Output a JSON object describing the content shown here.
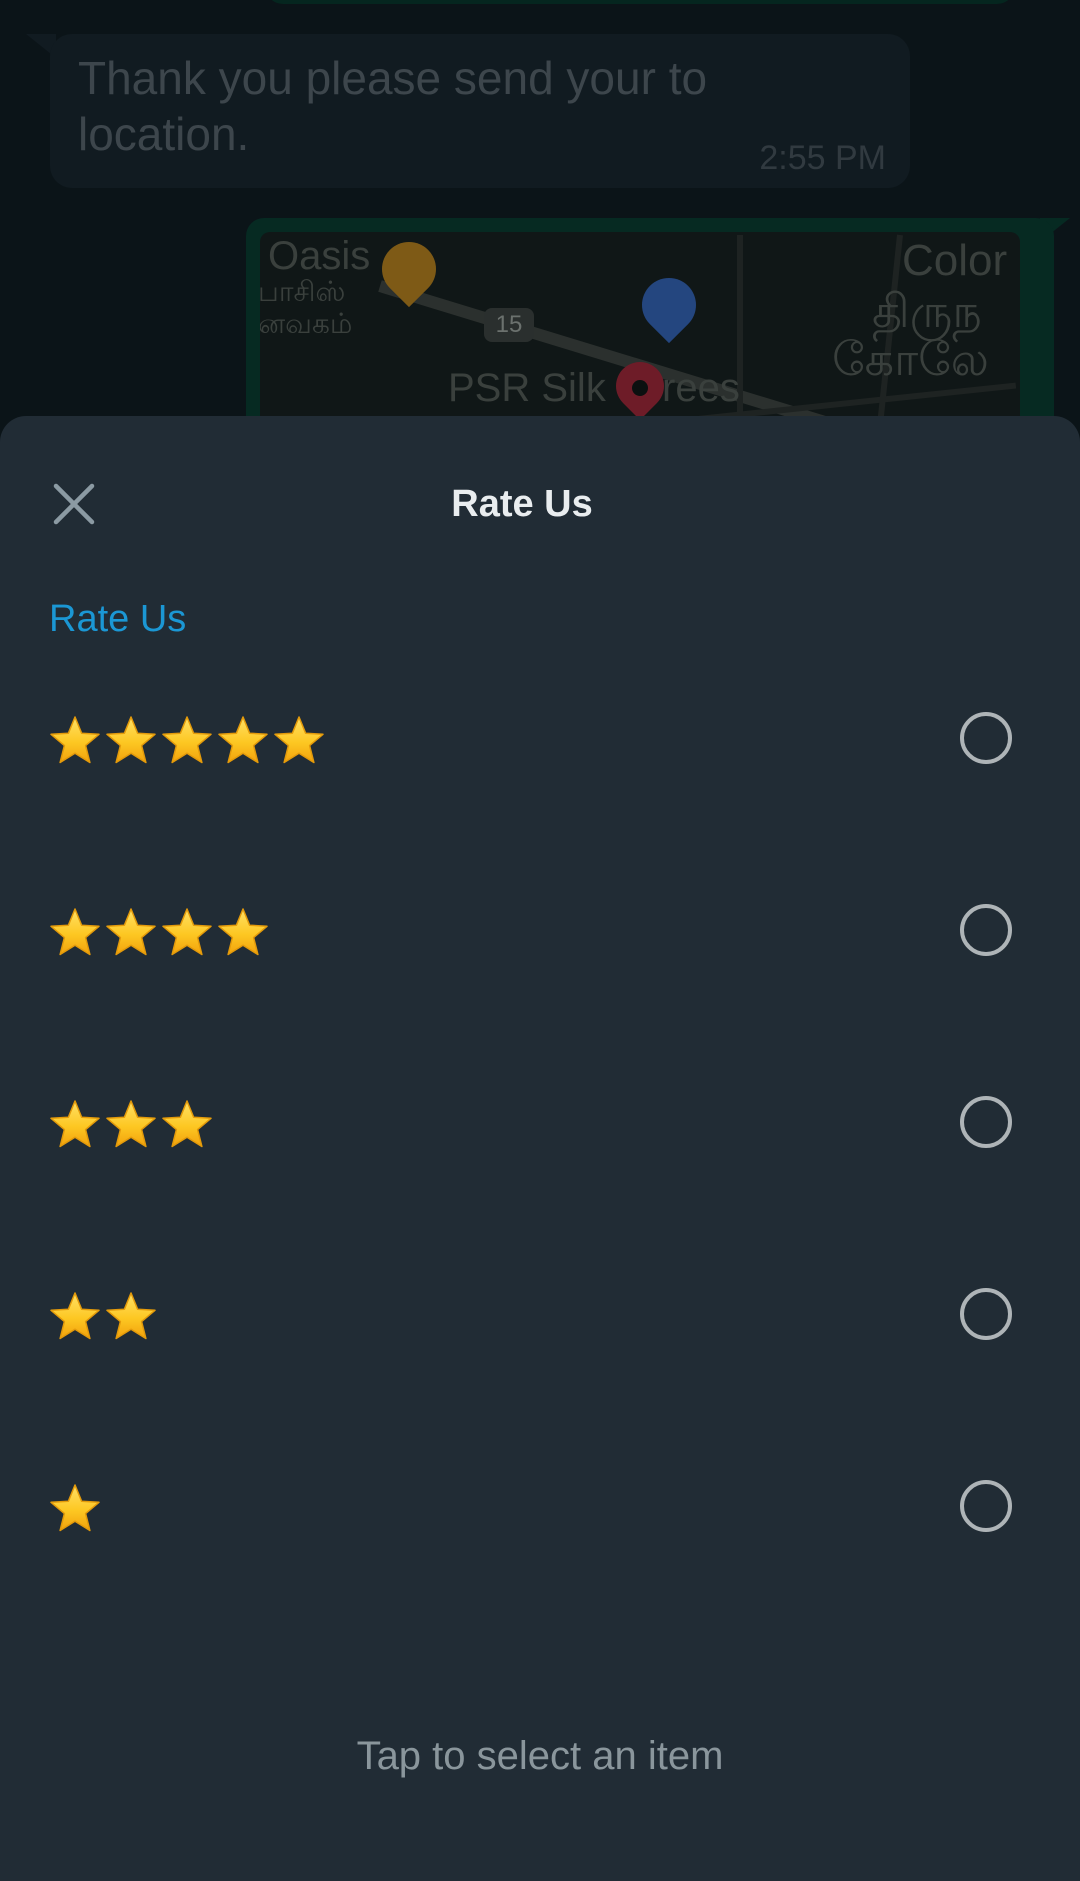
{
  "chat": {
    "incoming_message": {
      "text": "Thank you please send your to location.",
      "time": "2:55 PM"
    },
    "location_map": {
      "labels": {
        "oasis": "Oasis",
        "oasis_tamil_1": "பாசிஸ்",
        "oasis_tamil_2": "னவகம்",
        "route_number": "15",
        "psr": "PSR Silk",
        "sarees_fragment": "rees",
        "color": "Color",
        "tamil_right_1": "திருந",
        "tamil_right_2": "கோலே"
      },
      "pin_colors": {
        "restaurant": "#a7741a",
        "shopping": "#2f5aa6",
        "location": "#9e2738"
      }
    }
  },
  "sheet": {
    "title": "Rate Us",
    "section_label": "Rate Us",
    "options": [
      {
        "stars": 5,
        "selected": false
      },
      {
        "stars": 4,
        "selected": false
      },
      {
        "stars": 3,
        "selected": false
      },
      {
        "stars": 2,
        "selected": false
      },
      {
        "stars": 1,
        "selected": false
      }
    ],
    "hint": "Tap to select an item",
    "icons": {
      "close": "close-icon",
      "star": "star-icon",
      "radio": "radio-unchecked-icon"
    }
  },
  "colors": {
    "sheet_background": "#212c35",
    "accent": "#1b97d4",
    "title_text": "#e9edef",
    "hint_text": "#8a969c",
    "radio_border": "#aeb4b7",
    "star_fill": "#fdc823"
  }
}
